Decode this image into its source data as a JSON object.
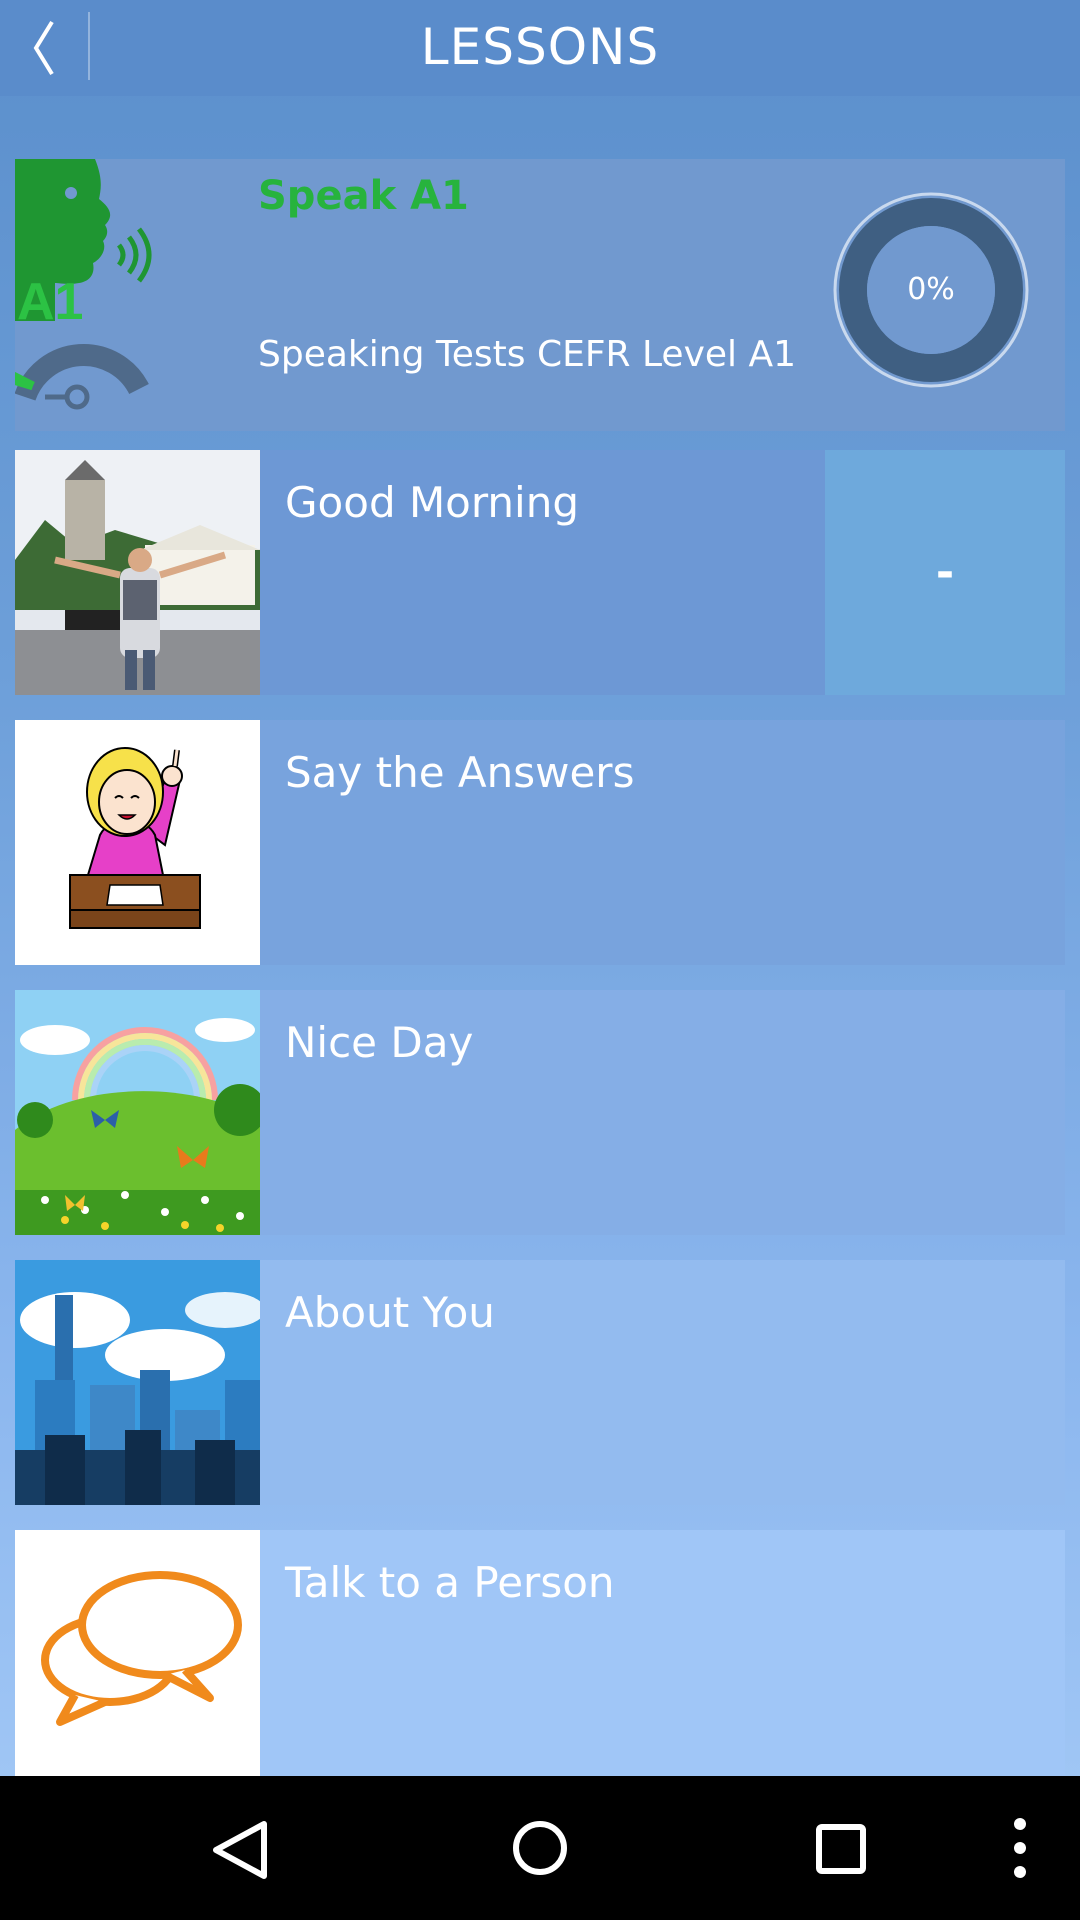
{
  "header": {
    "title": "LESSONS"
  },
  "course": {
    "title": "Speak A1",
    "icon_badge": "A1",
    "subtitle": "Speaking Tests CEFR Level A1",
    "progress": "0%",
    "progress_value": 0
  },
  "lessons": [
    {
      "label": "Good Morning",
      "score": "-"
    },
    {
      "label": "Say the Answers"
    },
    {
      "label": "Nice Day"
    },
    {
      "label": "About You"
    },
    {
      "label": "Talk to a Person"
    }
  ],
  "colors": {
    "accent_green": "#27b33d",
    "bar": "#5a8ccb",
    "orange": "#f08a1c"
  },
  "icons": {
    "back": "chevron-left-icon",
    "nav": [
      "back-triangle-icon",
      "home-circle-icon",
      "recents-square-icon",
      "more-vert-icon"
    ]
  }
}
